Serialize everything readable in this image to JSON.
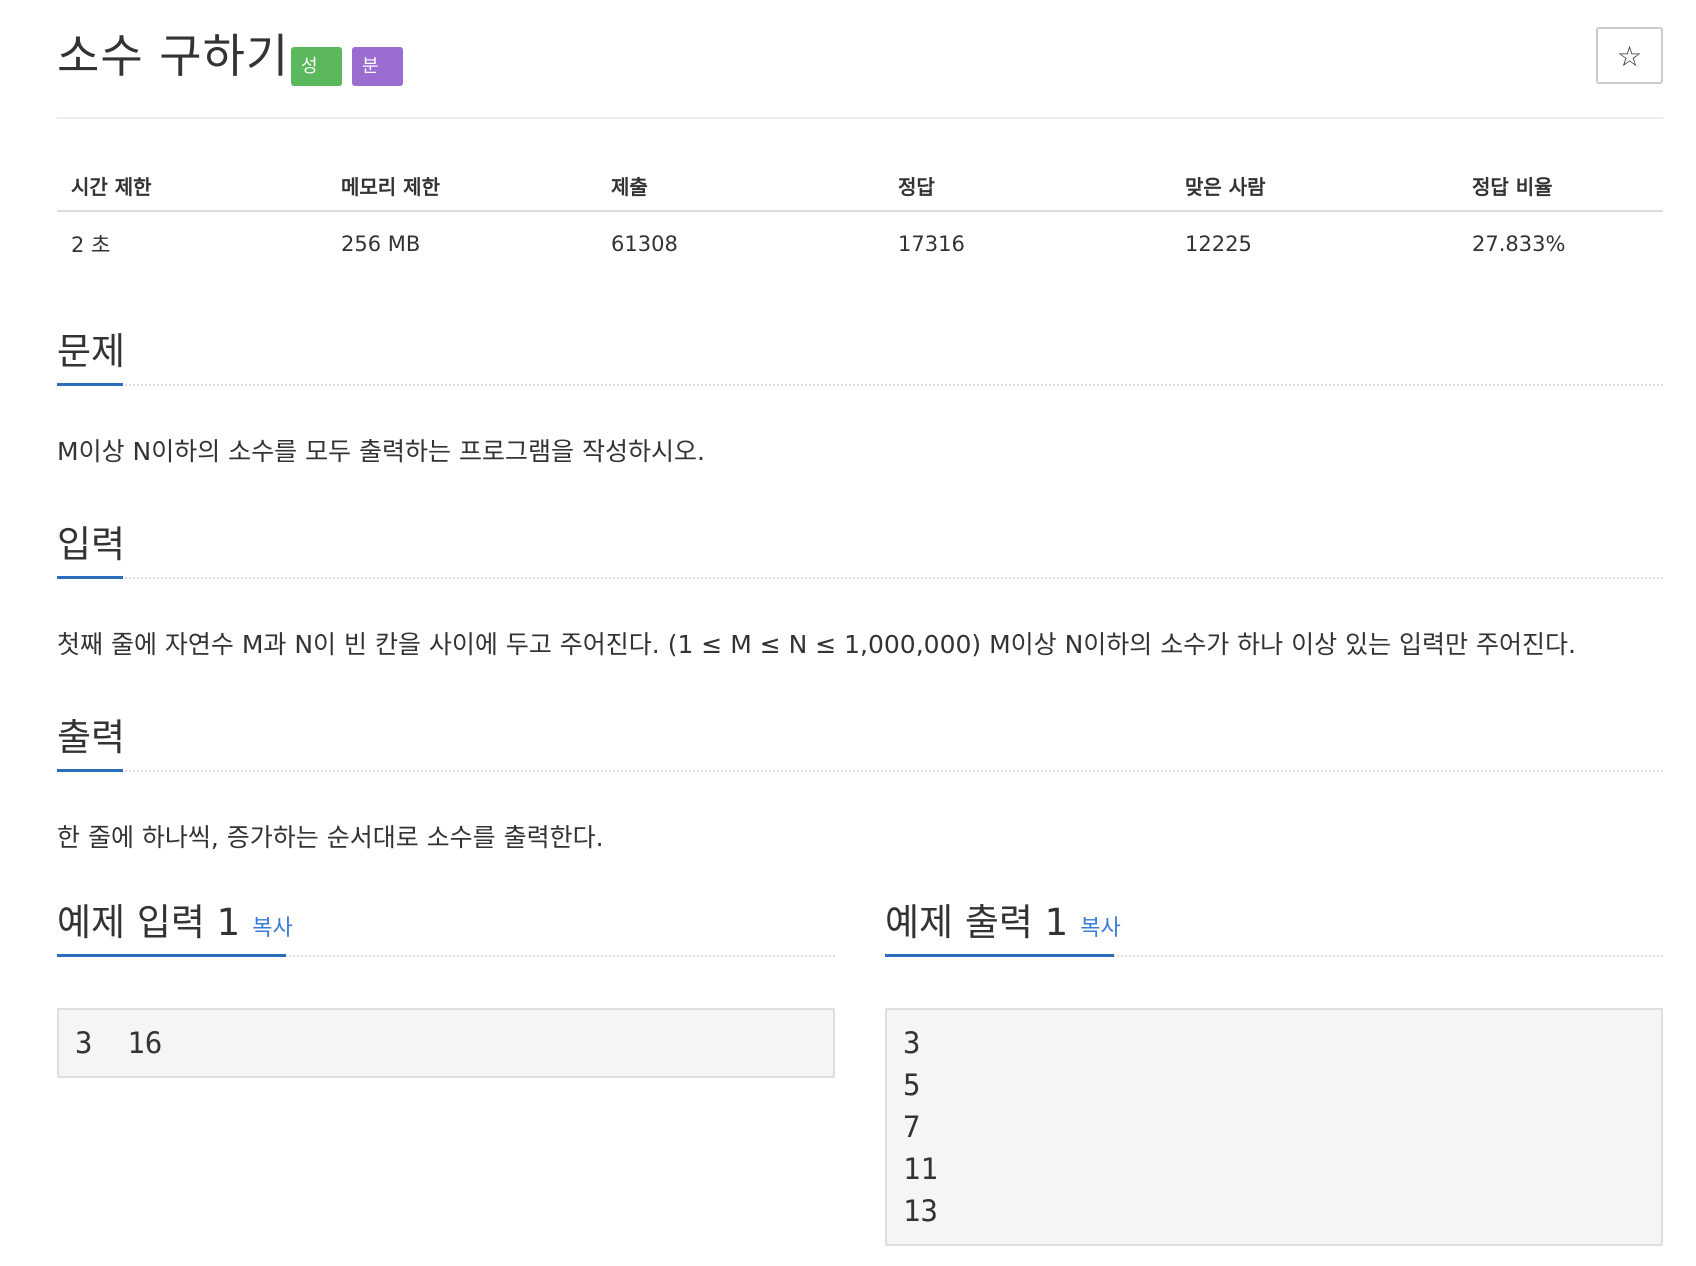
{
  "problem": {
    "title": "소수 구하기",
    "labels": {
      "success": "성공",
      "category": "분류"
    },
    "star_icon": "☆"
  },
  "colors": {
    "label_success": "#5cb85c",
    "label_category": "#9b6dd0",
    "accent": "#2a6ebb",
    "link": "#3a7bd5"
  },
  "info": {
    "headers": [
      "시간 제한",
      "메모리 제한",
      "제출",
      "정답",
      "맞은 사람",
      "정답 비율"
    ],
    "values": [
      "2 초",
      "256 MB",
      "61308",
      "17316",
      "12225",
      "27.833%"
    ]
  },
  "sections": {
    "description": {
      "title": "문제",
      "text": "M이상 N이하의 소수를 모두 출력하는 프로그램을 작성하시오."
    },
    "input": {
      "title": "입력",
      "text": "첫째 줄에 자연수 M과 N이 빈 칸을 사이에 두고 주어진다. (1 ≤ M ≤ N ≤ 1,000,000) M이상 N이하의 소수가 하나 이상 있는 입력만 주어진다."
    },
    "output": {
      "title": "출력",
      "text": "한 줄에 하나씩, 증가하는 순서대로 소수를 출력한다."
    }
  },
  "samples": {
    "input": {
      "title": "예제 입력 1",
      "copy_label": "복사",
      "content": "3  16"
    },
    "output": {
      "title": "예제 출력 1",
      "copy_label": "복사",
      "content": "3\n5\n7\n11\n13"
    }
  }
}
